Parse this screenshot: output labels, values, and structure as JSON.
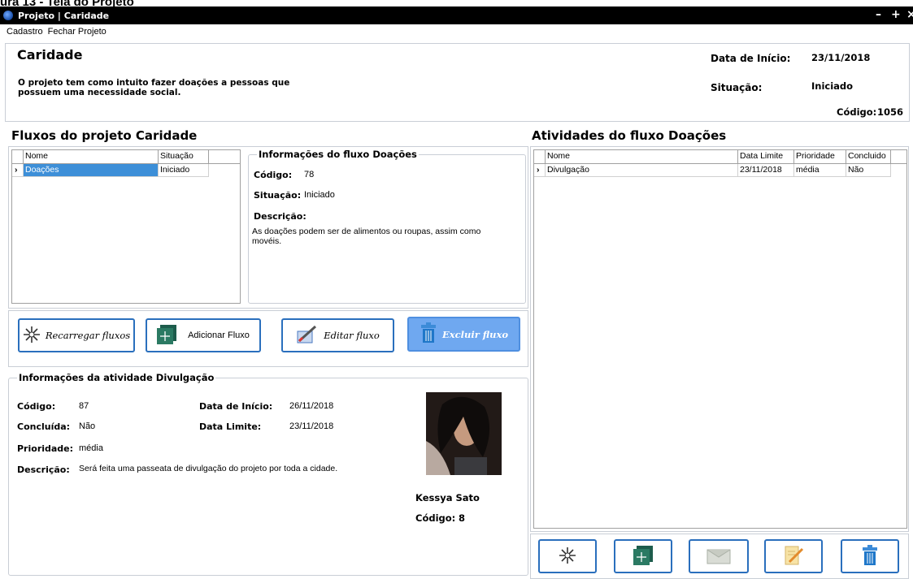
{
  "caption": "ura 13 - Tela do Projeto",
  "window": {
    "title": "Projeto | Caridade",
    "min": "–",
    "max": "+",
    "close": "×"
  },
  "menu": {
    "cadastro": "Cadastro",
    "fechar": "Fechar Projeto"
  },
  "project": {
    "name": "Caridade",
    "description": "O projeto tem como intuito fazer doações a pessoas que possuem uma necessidade social.",
    "start_label": "Data de Início:",
    "start_value": "23/11/2018",
    "status_label": "Situação:",
    "status_value": "Iniciado",
    "code_label": "Código:",
    "code_value": "1056"
  },
  "flows": {
    "title": "Fluxos do projeto Caridade",
    "columns": [
      "Nome",
      "Situação"
    ],
    "rows": [
      {
        "name": "Doações",
        "status": "Iniciado"
      }
    ]
  },
  "flow_info": {
    "title": "Informações do fluxo Doações",
    "code_label": "Código:",
    "code_value": "78",
    "status_label": "Situação:",
    "status_value": "Iniciado",
    "desc_label": "Descrição:",
    "desc_value": "As doações podem ser de alimentos ou roupas, assim como movéis."
  },
  "flow_buttons": {
    "reload": "Recarregar fluxos",
    "add": "Adicionar Fluxo",
    "edit": "Editar fluxo",
    "delete": "Excluir fluxo"
  },
  "activity_info": {
    "title": "Informações da atividade Divulgação",
    "code_label": "Código:",
    "code_value": "87",
    "done_label": "Concluída:",
    "done_value": "Não",
    "priority_label": "Prioridade:",
    "priority_value": "média",
    "desc_label": "Descrição:",
    "desc_value": "Será feita uma passeata de divulgação do projeto por toda a cidade.",
    "start_label": "Data de Início:",
    "start_value": "26/11/2018",
    "limit_label": "Data Limite:",
    "limit_value": "23/11/2018",
    "person_name": "Kessya Sato",
    "person_code_label": "Código:",
    "person_code_value": "8"
  },
  "activities": {
    "title": "Atividades do fluxo Doações",
    "columns": [
      "Nome",
      "Data Limite",
      "Prioridade",
      "Concluido"
    ],
    "rows": [
      {
        "name": "Divulgação",
        "limit": "23/11/2018",
        "priority": "média",
        "done": "Não"
      }
    ]
  },
  "colors": {
    "accent": "#2a6fbd",
    "selected_row": "#3d8fd8",
    "delete_btn": "#6fa8f0"
  }
}
